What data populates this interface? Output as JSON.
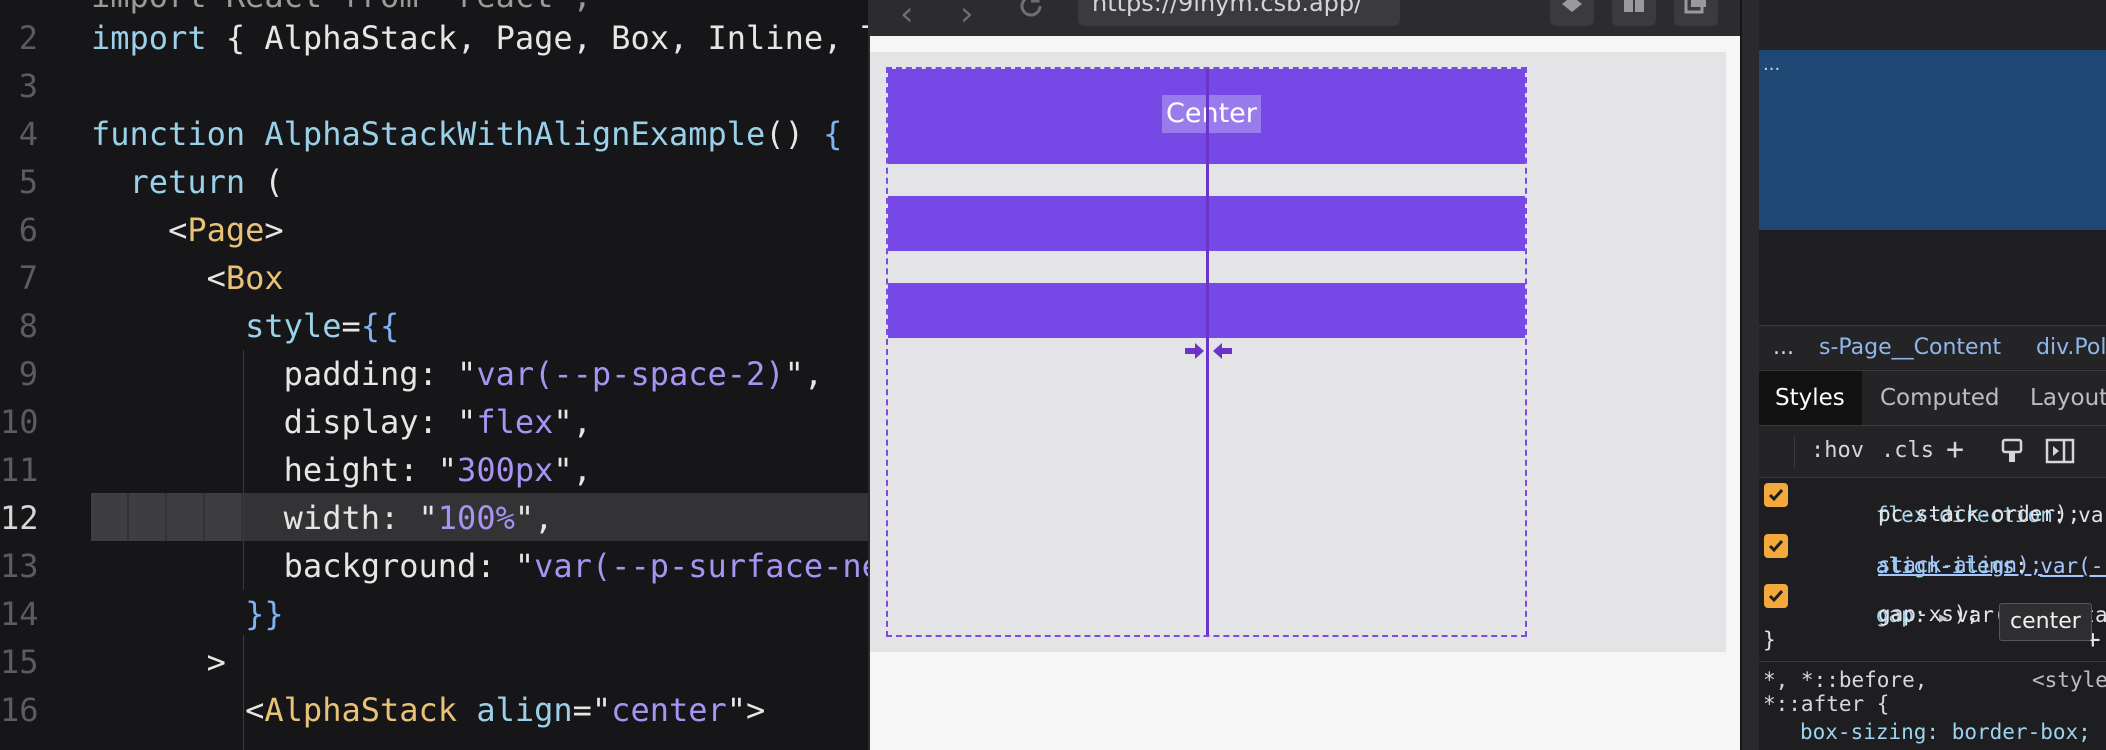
{
  "editor": {
    "lines": [
      {
        "num": "2",
        "tokens": [
          {
            "t": "import ",
            "c": "t-kw"
          },
          {
            "t": "{ ",
            "c": "t-punc"
          },
          {
            "t": "AlphaStack, Page, Box, Inline, T",
            "c": "t-def"
          }
        ]
      },
      {
        "num": "3",
        "tokens": []
      },
      {
        "num": "4",
        "tokens": [
          {
            "t": "function ",
            "c": "t-kw"
          },
          {
            "t": "AlphaStackWithAlignExample",
            "c": "t-fn"
          },
          {
            "t": "() ",
            "c": "t-def"
          },
          {
            "t": "{",
            "c": "t-brace"
          }
        ]
      },
      {
        "num": "5",
        "tokens": [
          {
            "t": "  return ",
            "c": "t-kw"
          },
          {
            "t": "(",
            "c": "t-def"
          }
        ]
      },
      {
        "num": "6",
        "tokens": [
          {
            "t": "    <",
            "c": "t-punc"
          },
          {
            "t": "Page",
            "c": "t-tag"
          },
          {
            "t": ">",
            "c": "t-punc"
          }
        ]
      },
      {
        "num": "7",
        "tokens": [
          {
            "t": "      <",
            "c": "t-punc"
          },
          {
            "t": "Box",
            "c": "t-tag"
          }
        ]
      },
      {
        "num": "8",
        "tokens": [
          {
            "t": "        style",
            "c": "t-kw"
          },
          {
            "t": "=",
            "c": "t-def"
          },
          {
            "t": "{{",
            "c": "t-brace"
          }
        ]
      },
      {
        "num": "9",
        "tokens": [
          {
            "t": "          padding: ",
            "c": "t-def"
          },
          {
            "t": "\"",
            "c": "t-def"
          },
          {
            "t": "var(--p-space-2)",
            "c": "t-str"
          },
          {
            "t": "\",",
            "c": "t-def"
          }
        ]
      },
      {
        "num": "10",
        "tokens": [
          {
            "t": "          display: ",
            "c": "t-def"
          },
          {
            "t": "\"",
            "c": "t-def"
          },
          {
            "t": "flex",
            "c": "t-str"
          },
          {
            "t": "\",",
            "c": "t-def"
          }
        ]
      },
      {
        "num": "11",
        "tokens": [
          {
            "t": "          height: ",
            "c": "t-def"
          },
          {
            "t": "\"",
            "c": "t-def"
          },
          {
            "t": "300px",
            "c": "t-str"
          },
          {
            "t": "\",",
            "c": "t-def"
          }
        ]
      },
      {
        "num": "12",
        "tokens": [
          {
            "t": "          width: ",
            "c": "t-def"
          },
          {
            "t": "\"",
            "c": "t-def"
          },
          {
            "t": "100%",
            "c": "t-str"
          },
          {
            "t": "\",",
            "c": "t-def"
          }
        ]
      },
      {
        "num": "13",
        "tokens": [
          {
            "t": "          background: ",
            "c": "t-def"
          },
          {
            "t": "\"",
            "c": "t-def"
          },
          {
            "t": "var(--p-surface-ne",
            "c": "t-str"
          }
        ]
      },
      {
        "num": "14",
        "tokens": [
          {
            "t": "        }}",
            "c": "t-brace"
          }
        ]
      },
      {
        "num": "15",
        "tokens": [
          {
            "t": "      >",
            "c": "t-punc"
          }
        ]
      },
      {
        "num": "16",
        "tokens": [
          {
            "t": "        <",
            "c": "t-punc"
          },
          {
            "t": "AlphaStack ",
            "c": "t-tag"
          },
          {
            "t": "align",
            "c": "t-kw"
          },
          {
            "t": "=\"",
            "c": "t-def"
          },
          {
            "t": "center",
            "c": "t-str"
          },
          {
            "t": "\">",
            "c": "t-def"
          }
        ]
      }
    ],
    "active_line": "12"
  },
  "browser": {
    "back_icon": "chevron-left-icon",
    "forward_icon": "chevron-right-icon",
    "reload_icon": "reload-icon",
    "url": "https://9lnym.csb.app/",
    "preview": {
      "center_label": "Center",
      "accent_color": "#7649e6"
    }
  },
  "devtools": {
    "selected_ellipsis": "...",
    "breadcrumbs": {
      "more": "...",
      "item1": "s-Page__Content",
      "item2": "div.Polar"
    },
    "tabs": [
      "Styles",
      "Computed",
      "Layout"
    ],
    "active_tab": "Styles",
    "filter": {
      "hov": ":hov",
      "cls": ".cls",
      "add": "+"
    },
    "rules": {
      "flex_direction": {
        "name": "flex-direction",
        "value_a": "var(--",
        "value_b": "pc-stack-order);"
      },
      "align_items": {
        "name": "align-items",
        "value_a": "var(--pc-",
        "value_b": "stack-align);"
      },
      "gap": {
        "name": "gap",
        "value_a": "var(--pc-stack-",
        "value_b": "gap-xs);"
      },
      "close_brace": "}",
      "add": "+",
      "selector_a": "*, *::before,",
      "selector_b": "*::after {",
      "style_tag": "<style>",
      "box_sizing": "box-sizing: border-box;"
    },
    "tooltip": "center"
  }
}
